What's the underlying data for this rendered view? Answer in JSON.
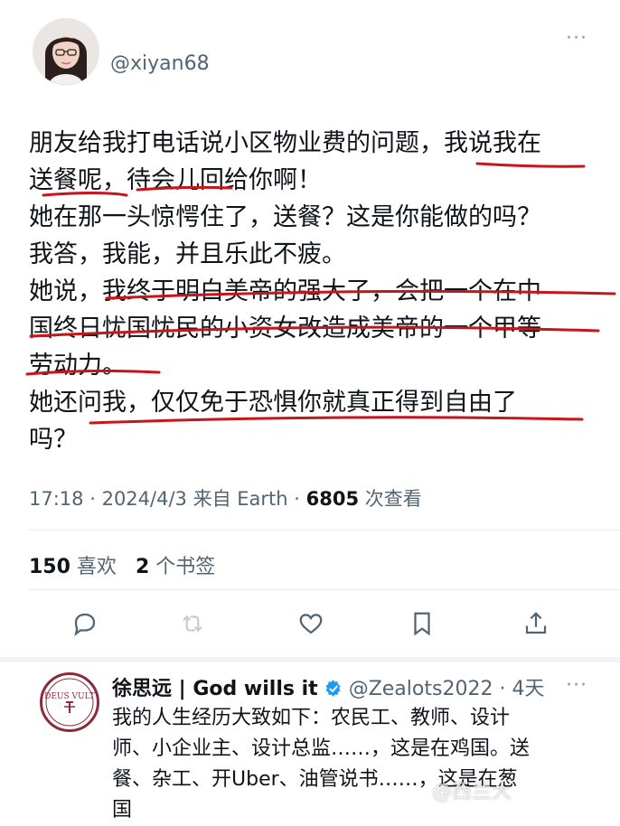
{
  "tweet": {
    "handle": "@xiyan68",
    "more_label": "···",
    "lines": [
      "朋友给我打电话说小区物业费的问题，我说我在",
      "送餐呢，待会儿回给你啊！",
      "她在那一头惊愕住了，送餐？这是你能做的吗？",
      "我答，我能，并且乐此不疲。",
      "她说，我终于明白美帝的强大了，会把一个在中",
      "国终日忧国忧民的小资女改造成美帝的一个甲等",
      "劳动力。",
      "她还问我，仅仅免于恐惧你就真正得到自由了",
      "吗？"
    ],
    "time": "17:18",
    "date": "2024/4/3",
    "source_prefix": "来自",
    "source": "Earth",
    "views": "6805",
    "views_label": "次查看",
    "likes": "150",
    "likes_label": "喜欢",
    "bookmarks": "2",
    "bookmarks_label": "个书签",
    "underline_color": "#c4161c"
  },
  "actions": {
    "icons": [
      "reply-icon",
      "retweet-icon",
      "like-icon",
      "bookmark-icon",
      "share-icon"
    ]
  },
  "reply": {
    "name": "徐思远 | God wills it",
    "handle": "@Zealots2022",
    "time": "4天",
    "lines": [
      "我的人生经历大致如下：农民工、教师、设计",
      "师、小企业主、设计总监……，这是在鸡国。送",
      "餐、杂工、开Uber、油管说书……，这是在葱",
      "国"
    ],
    "avatar_text": "DEUS VULT",
    "verified_color": "#1d9bf0"
  },
  "watermark": "@西兰大"
}
